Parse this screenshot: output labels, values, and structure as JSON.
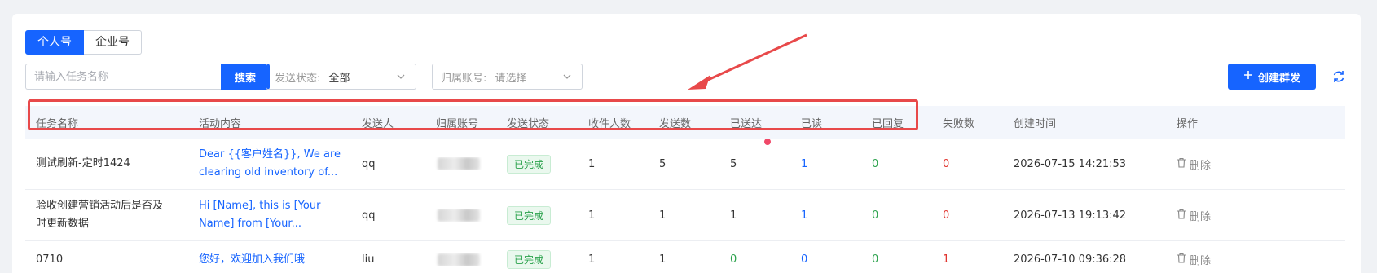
{
  "tabs": [
    "个人号",
    "企业号"
  ],
  "search": {
    "placeholder": "请输入任务名称",
    "button": "搜索"
  },
  "filters": {
    "send_status": {
      "label": "发送状态:",
      "value": "全部"
    },
    "account": {
      "label": "归属账号:",
      "placeholder": "请选择"
    }
  },
  "create_button": "创建群发",
  "table": {
    "columns": [
      "任务名称",
      "活动内容",
      "发送人",
      "归属账号",
      "发送状态",
      "收件人数",
      "发送数",
      "已送达",
      "已读",
      "已回复",
      "失败数",
      "创建时间",
      "操作"
    ],
    "rows": [
      {
        "name": "测试刷新-定时1424",
        "content_line1": "Dear {{客户姓名}}, We are",
        "content_line2": "clearing old inventory of...",
        "sender": "qq",
        "status": "已完成",
        "recipients": "1",
        "sent": "5",
        "delivered": "5",
        "read": "1",
        "replied": "0",
        "failed": "0",
        "created": "2026-07-15 14:21:53",
        "action": "删除"
      },
      {
        "name_line1": "验收创建营销活动后是否及",
        "name_line2": "时更新数据",
        "content_line1": "Hi [Name], this is [Your",
        "content_line2": "Name] from [Your...",
        "sender": "qq",
        "status": "已完成",
        "recipients": "1",
        "sent": "1",
        "delivered": "1",
        "read": "1",
        "replied": "0",
        "failed": "0",
        "created": "2026-07-13 19:13:42",
        "action": "删除"
      },
      {
        "name": "0710",
        "content_line1": "您好，欢迎加入我们哦",
        "sender": "liu",
        "status": "已完成",
        "recipients": "1",
        "sent": "1",
        "delivered": "0",
        "read": "0",
        "replied": "0",
        "failed": "1",
        "created": "2026-07-10 09:36:28",
        "action": "删除"
      }
    ]
  },
  "colors": {
    "primary": "#1664ff",
    "annotation": "#e8494a",
    "success": "#2ba24c",
    "danger": "#e0312b"
  }
}
